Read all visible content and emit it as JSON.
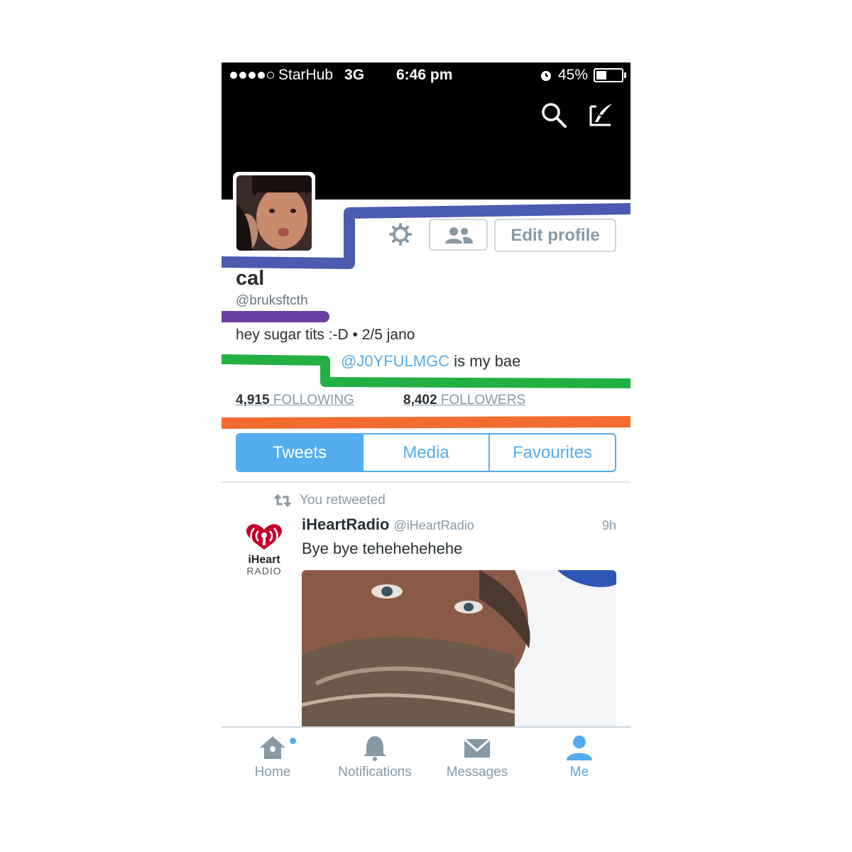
{
  "status_bar": {
    "carrier": "StarHub",
    "network": "3G",
    "time": "6:46 pm",
    "battery": "45%",
    "battery_level": 0.45,
    "signal_bars": 4
  },
  "header": {
    "search_icon": "search-icon",
    "compose_icon": "compose-tweet-icon"
  },
  "profile": {
    "name": "cal",
    "handle": "@bruksftcth",
    "bio_line1": "hey sugar tits :-D • 2/5 jano",
    "bio_mention": "@J0YFULMGC",
    "bio_line2_rest": " is my bae",
    "following_count": "4,915",
    "following_label": " FOLLOWING",
    "followers_count": "8,402",
    "followers_label": " FOLLOWERS",
    "edit_profile_label": "Edit profile"
  },
  "tabs": [
    {
      "label": "Tweets",
      "active": true
    },
    {
      "label": "Media",
      "active": false
    },
    {
      "label": "Favourites",
      "active": false
    }
  ],
  "tweet": {
    "retweet_note": "You retweeted",
    "author": "iHeartRadio",
    "author_handle": "@iHeartRadio",
    "time": "9h",
    "text": "Bye bye tehehehehehe",
    "avatar_text_top": "iHeart",
    "avatar_text_bottom": "RADIO"
  },
  "tabbar": [
    {
      "label": "Home",
      "icon": "home-icon",
      "active": false,
      "badge": true
    },
    {
      "label": "Notifications",
      "icon": "bell-icon",
      "active": false,
      "badge": false
    },
    {
      "label": "Messages",
      "icon": "envelope-icon",
      "active": false,
      "badge": false
    },
    {
      "label": "Me",
      "icon": "person-icon",
      "active": true,
      "badge": false
    }
  ],
  "colors": {
    "accent": "#55acee",
    "scribble_blue": "#4a5bb0",
    "scribble_purple": "#6a3fa0",
    "scribble_green": "#22b045",
    "scribble_orange": "#f26b30"
  }
}
